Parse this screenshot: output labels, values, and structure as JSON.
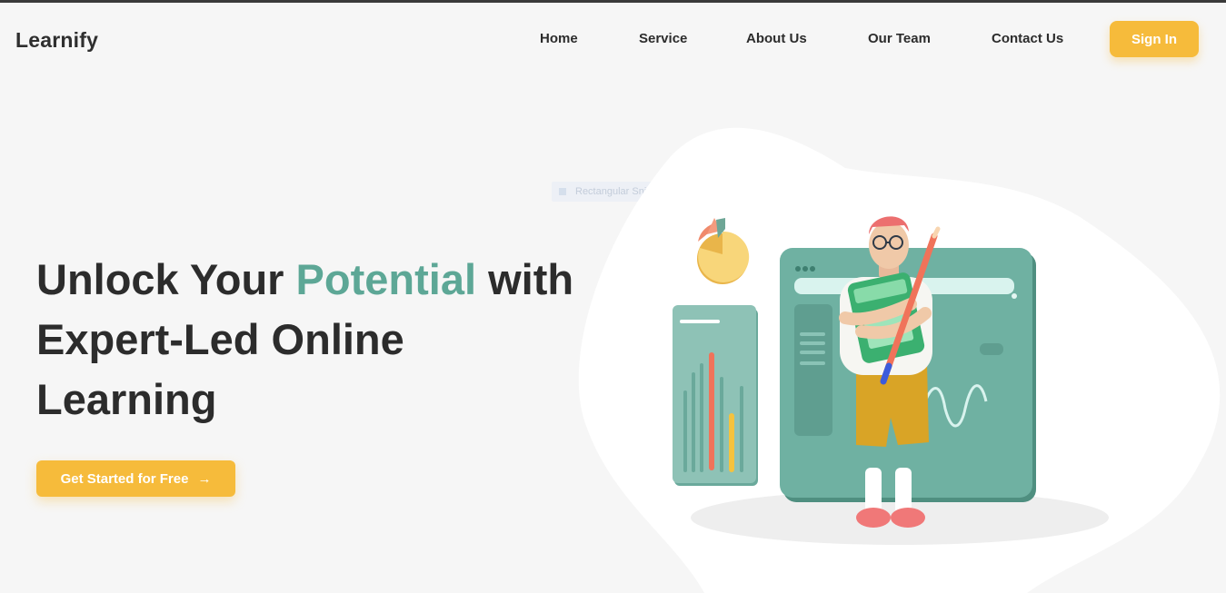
{
  "brand": "Learnify",
  "nav": {
    "items": [
      {
        "label": "Home"
      },
      {
        "label": "Service"
      },
      {
        "label": "About Us"
      },
      {
        "label": "Our Team"
      },
      {
        "label": "Contact Us"
      }
    ],
    "signin_label": "Sign In"
  },
  "hero": {
    "headline_part1": "Unlock Your ",
    "headline_accent": "Potential",
    "headline_part2": " with Expert-Led Online Learning",
    "cta_label": "Get Started for Free",
    "cta_icon": "arrow-right-icon"
  },
  "ghost_label": "Rectangular Snip",
  "colors": {
    "accent_yellow": "#f6bb3b",
    "accent_teal": "#5da796",
    "text_dark": "#2c2c2c",
    "background": "#f6f6f6"
  }
}
